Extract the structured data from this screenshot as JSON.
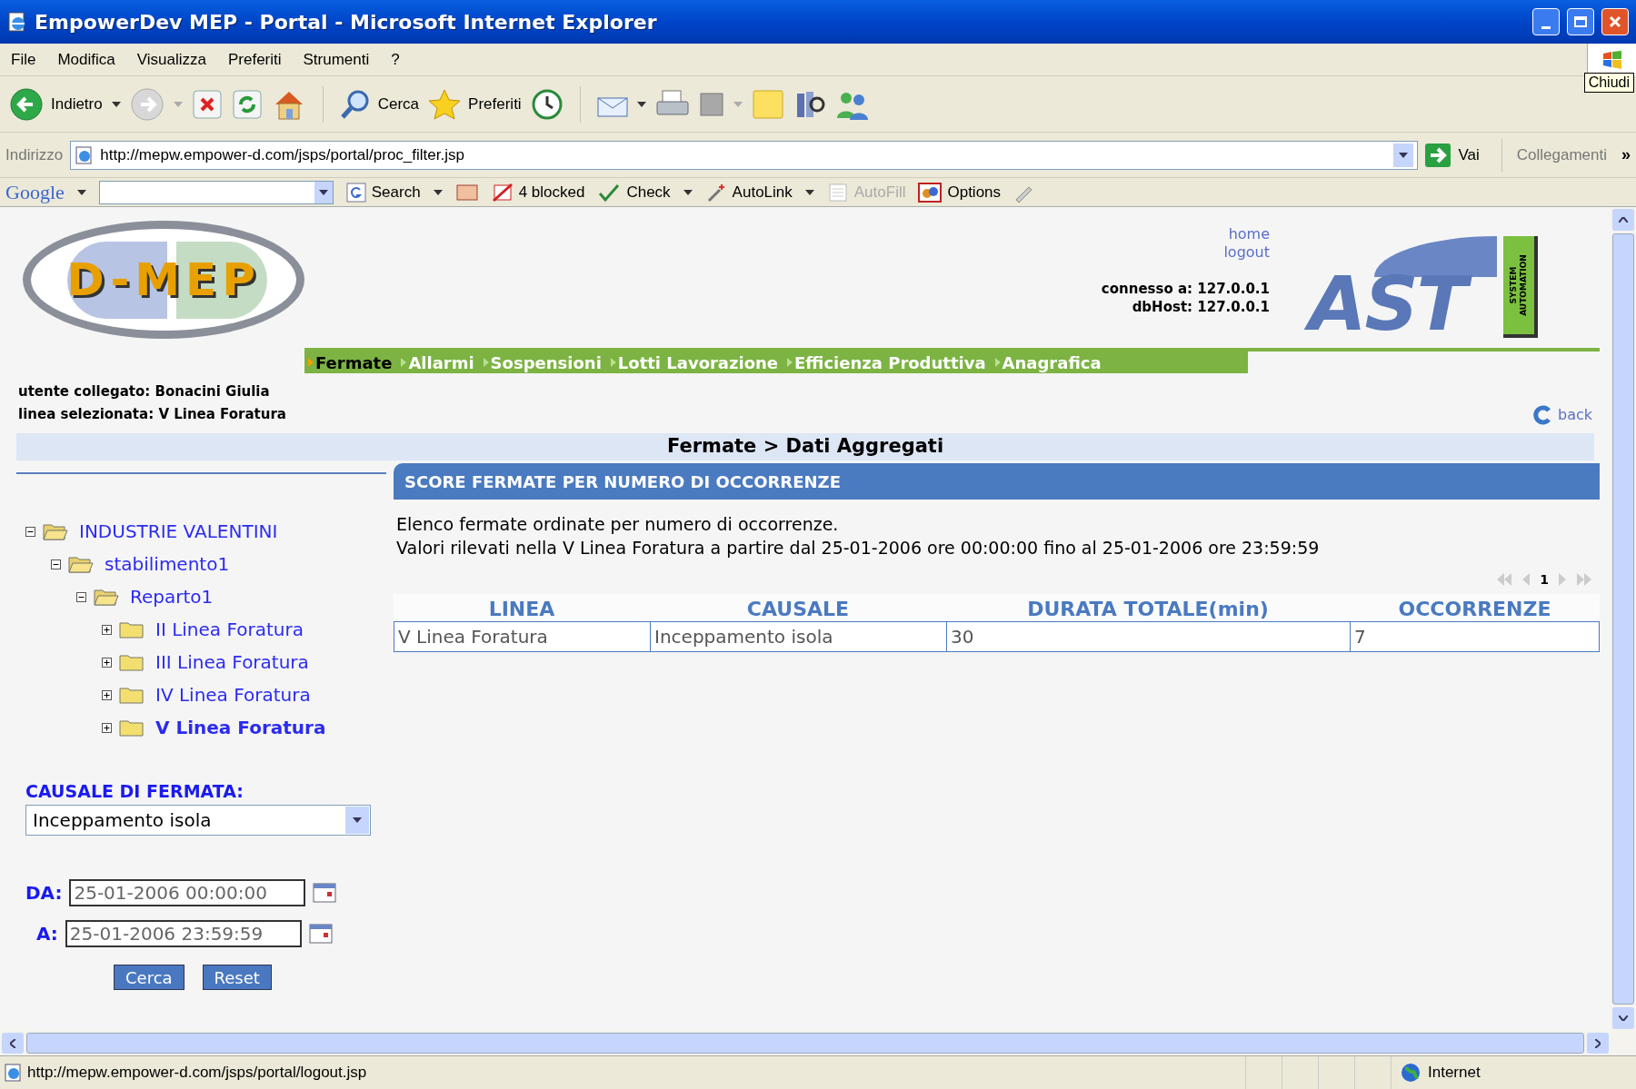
{
  "window": {
    "title": "EmpowerDev MEP - Portal - Microsoft Internet Explorer",
    "tooltip": "Chiudi"
  },
  "menu": [
    "File",
    "Modifica",
    "Visualizza",
    "Preferiti",
    "Strumenti",
    "?"
  ],
  "toolbar": {
    "back": "Indietro",
    "search": "Cerca",
    "favorites": "Preferiti"
  },
  "address_bar": {
    "label": "Indirizzo",
    "url": "http://mepw.empower-d.com/jsps/portal/proc_filter.jsp",
    "go": "Vai",
    "links": "Collegamenti",
    "more": "»"
  },
  "google_bar": {
    "logo": "Google",
    "search": "Search",
    "blocked": "4 blocked",
    "check": "Check",
    "autolink": "AutoLink",
    "autofill": {
      "label": "AutoFill",
      "disabled": true
    },
    "options": "Options"
  },
  "header": {
    "logo": "D-MEP",
    "links": [
      "home",
      "logout"
    ],
    "connection": [
      "connesso a: 127.0.0.1",
      "dbHost: 127.0.0.1"
    ],
    "brand_logo": {
      "letters": "AST",
      "tagline": [
        "SYSTEM",
        "AUTOMATION"
      ]
    }
  },
  "nav": [
    {
      "label": "Fermate",
      "selected": true
    },
    {
      "label": "Allarmi",
      "selected": false
    },
    {
      "label": "Sospensioni",
      "selected": false
    },
    {
      "label": "Lotti Lavorazione",
      "selected": false
    },
    {
      "label": "Efficienza Produttiva",
      "selected": false
    },
    {
      "label": "Anagrafica",
      "selected": false
    }
  ],
  "user_info": [
    "utente collegato: Bonacini Giulia",
    "linea selezionata: V Linea Foratura"
  ],
  "back_link": "back",
  "breadcrumb": "Fermate > Dati Aggregati",
  "tree": [
    {
      "label": "INDUSTRIE VALENTINI",
      "expanded": true,
      "selected": false,
      "children": [
        {
          "label": "stabilimento1",
          "expanded": true,
          "selected": false,
          "children": [
            {
              "label": "Reparto1",
              "expanded": true,
              "selected": false,
              "children": [
                {
                  "label": "II Linea Foratura",
                  "expanded": false,
                  "selected": false
                },
                {
                  "label": "III Linea Foratura",
                  "expanded": false,
                  "selected": false
                },
                {
                  "label": "IV Linea Foratura",
                  "expanded": false,
                  "selected": false
                },
                {
                  "label": "V Linea Foratura",
                  "expanded": false,
                  "selected": true
                }
              ]
            }
          ]
        }
      ]
    }
  ],
  "filter": {
    "causale_label": "CAUSALE DI FERMATA:",
    "causale_value": "Inceppamento isola",
    "from_label": "DA:",
    "from_value": "25-01-2006 00:00:00",
    "to_label": "A:",
    "to_value": "25-01-2006 23:59:59",
    "buttons": [
      "Cerca",
      "Reset"
    ]
  },
  "report": {
    "title": "SCORE FERMATE PER NUMERO DI OCCORRENZE",
    "description": [
      "Elenco fermate ordinate per numero di occorrenze.",
      "Valori rilevati nella V Linea Foratura a partire dal 25-01-2006 ore 00:00:00 fino al 25-01-2006 ore 23:59:59"
    ],
    "page": "1",
    "table": {
      "columns": [
        "LINEA",
        "CAUSALE",
        "DURATA TOTALE(min)",
        "OCCORRENZE"
      ],
      "rows": [
        [
          "V Linea Foratura",
          "Inceppamento isola",
          "30",
          "7"
        ]
      ]
    }
  },
  "status_bar": {
    "url": "http://mepw.empower-d.com/jsps/portal/logout.jsp",
    "zone": "Internet"
  }
}
